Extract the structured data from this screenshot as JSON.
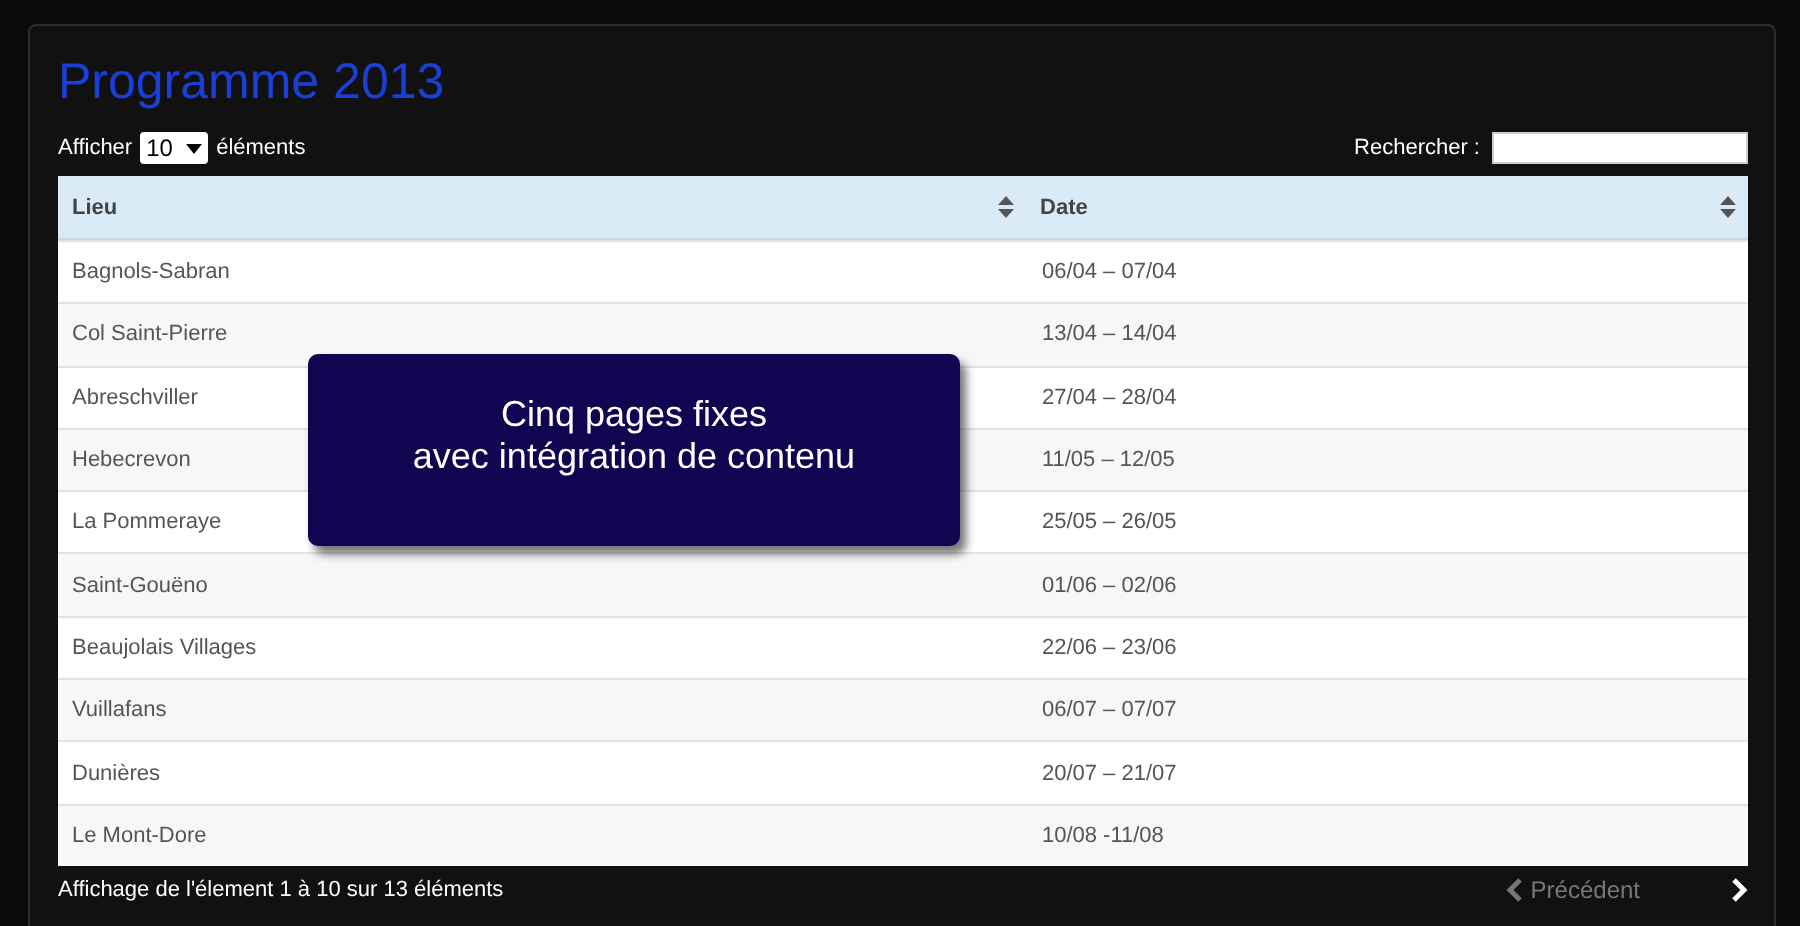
{
  "title": "Programme 2013",
  "length_menu": {
    "before": "Afficher",
    "value": "10",
    "after": "éléments"
  },
  "search": {
    "label": "Rechercher :"
  },
  "table": {
    "columns": [
      "Lieu",
      "Date"
    ],
    "rows": [
      [
        "Bagnols-Sabran",
        "06/04 – 07/04"
      ],
      [
        "Col Saint-Pierre",
        "13/04 – 14/04"
      ],
      [
        "Abreschviller",
        "27/04 – 28/04"
      ],
      [
        "Hebecrevon",
        "11/05 – 12/05"
      ],
      [
        "La Pommeraye",
        "25/05 – 26/05"
      ],
      [
        "Saint-Gouëno",
        "01/06 – 02/06"
      ],
      [
        "Beaujolais Villages",
        "22/06 – 23/06"
      ],
      [
        "Vuillafans",
        "06/07 – 07/07"
      ],
      [
        "Dunières",
        "20/07 – 21/07"
      ],
      [
        "Le Mont-Dore",
        "10/08 -11/08"
      ]
    ]
  },
  "info": "Affichage de l'élement 1 à 10 sur 13 éléments",
  "pagination": {
    "previous": {
      "label": "Précédent",
      "disabled": true
    },
    "next": {
      "disabled": false
    }
  },
  "callout": {
    "lines": [
      "Cinq pages fixes",
      "avec intégration de contenu"
    ]
  }
}
